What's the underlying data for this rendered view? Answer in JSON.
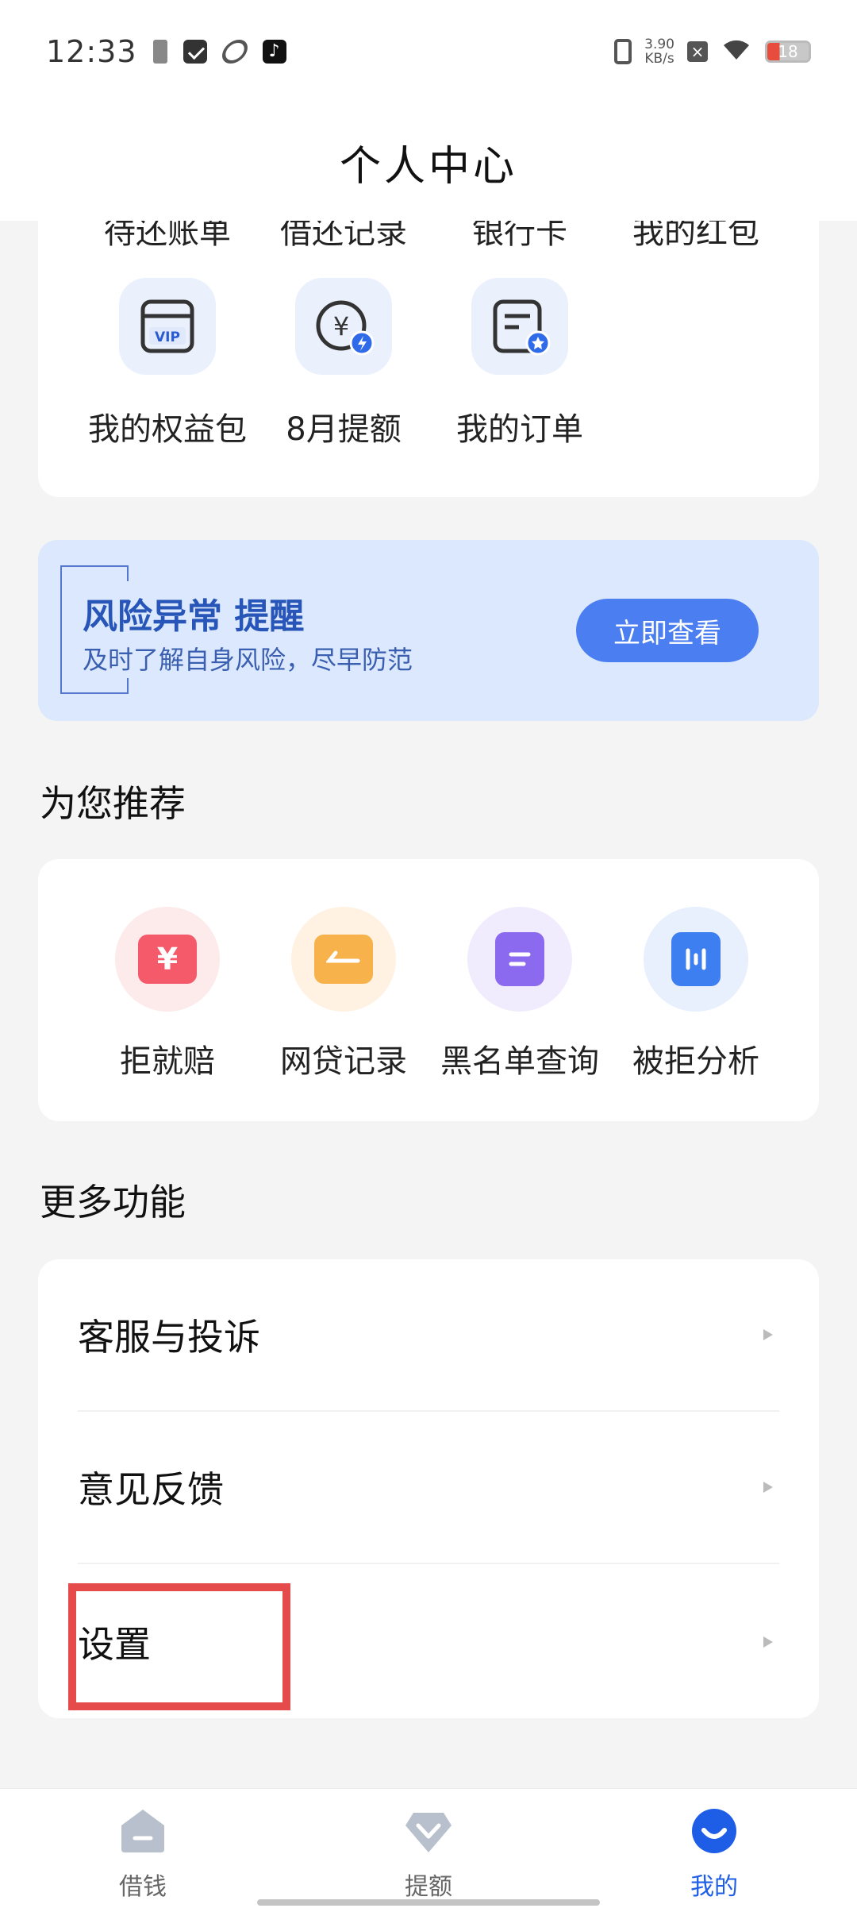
{
  "status_bar": {
    "time": "12:33",
    "tiktok_glyph": "♪",
    "net_speed_value": "3.90",
    "net_speed_unit": "KB/s",
    "battery": "18",
    "icons": [
      "battery-saver-icon",
      "mail-icon",
      "loop-icon",
      "tiktok-icon",
      "vibrate-icon",
      "close-notification-icon",
      "wifi-icon",
      "battery-icon"
    ]
  },
  "header": {
    "title": "个人中心"
  },
  "services": {
    "clipped_labels": [
      "待还账单",
      "借还记录",
      "银行卡",
      "我的红包"
    ],
    "items": [
      {
        "label": "我的权益包",
        "icon": "vip-card-icon"
      },
      {
        "label": "8月提额",
        "icon": "yuan-boost-icon"
      },
      {
        "label": "我的订单",
        "icon": "order-star-icon"
      }
    ]
  },
  "risk_banner": {
    "title": "风险异常 提醒",
    "subtitle": "及时了解自身风险，尽早防范",
    "button": "立即查看",
    "accent": "#4b7ef0"
  },
  "recommend": {
    "title": "为您推荐",
    "items": [
      {
        "label": "拒就赔",
        "icon": "yuan-compensation-icon",
        "glyph": "¥",
        "color": "#f45a6a",
        "bg": "#fdeaea"
      },
      {
        "label": "网贷记录",
        "icon": "loan-record-icon",
        "glyph": "",
        "color": "#f8b24c",
        "bg": "#fff2e3"
      },
      {
        "label": "黑名单查询",
        "icon": "blacklist-query-icon",
        "glyph": "",
        "color": "#8b6af0",
        "bg": "#f1ecfd"
      },
      {
        "label": "被拒分析",
        "icon": "rejection-analysis-icon",
        "glyph": "",
        "color": "#3d7ef0",
        "bg": "#e8effd"
      }
    ]
  },
  "more": {
    "title": "更多功能",
    "items": [
      {
        "label": "客服与投诉"
      },
      {
        "label": "意见反馈"
      },
      {
        "label": "设置"
      }
    ]
  },
  "bottom_nav": {
    "items": [
      {
        "label": "借钱",
        "icon": "home-borrow-icon",
        "active": false
      },
      {
        "label": "提额",
        "icon": "diamond-limit-icon",
        "active": false
      },
      {
        "label": "我的",
        "icon": "profile-smile-icon",
        "active": true
      }
    ]
  }
}
